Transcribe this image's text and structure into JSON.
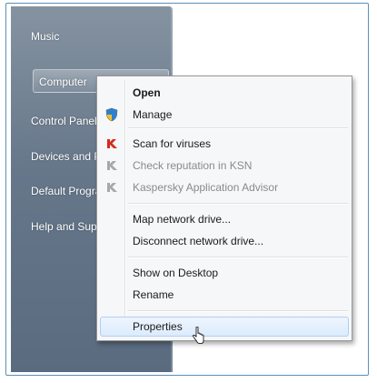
{
  "start_menu": {
    "items": [
      {
        "label": "Music"
      },
      {
        "label": "Computer"
      },
      {
        "label": "Control Panel"
      },
      {
        "label": "Devices and Printers"
      },
      {
        "label": "Default Programs"
      },
      {
        "label": "Help and Support"
      }
    ]
  },
  "context_menu": {
    "items": [
      {
        "label": "Open",
        "bold": true
      },
      {
        "label": "Manage",
        "icon": "shield-icon"
      },
      {
        "label": "Scan for viruses",
        "icon": "kaspersky-icon"
      },
      {
        "label": "Check reputation in KSN",
        "icon": "kaspersky-ksn-icon",
        "disabled": true
      },
      {
        "label": "Kaspersky Application Advisor",
        "icon": "kaspersky-advisor-icon",
        "disabled": true
      },
      {
        "label": "Map network drive..."
      },
      {
        "label": "Disconnect network drive..."
      },
      {
        "label": "Show on Desktop"
      },
      {
        "label": "Rename"
      },
      {
        "label": "Properties",
        "hovered": true
      }
    ]
  },
  "colors": {
    "start_pane": "#66778a",
    "menu_bg": "#f6f7f9",
    "hover_border": "#aecff7",
    "kaspersky_red": "#d52b1e"
  }
}
